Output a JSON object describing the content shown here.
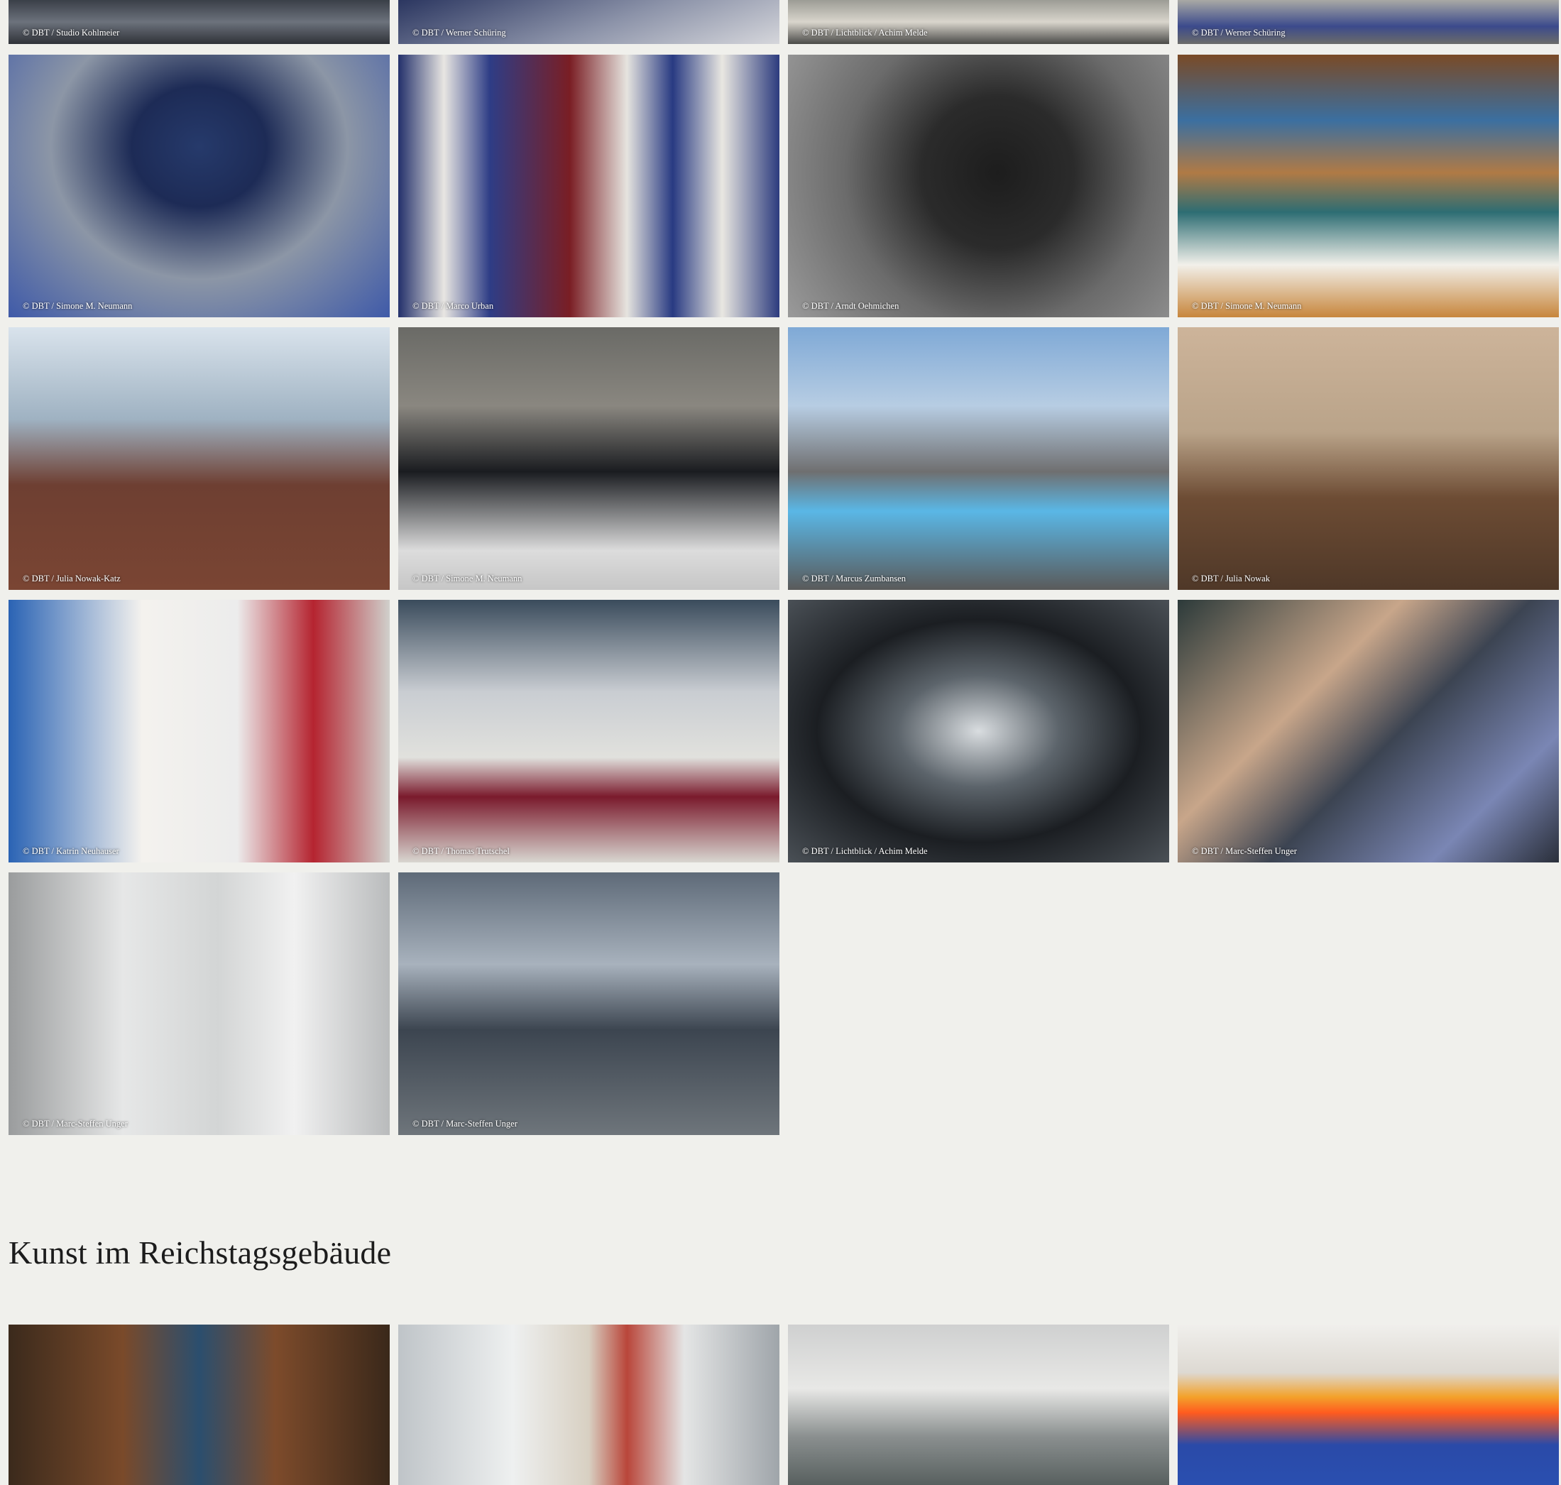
{
  "top_row": [
    {
      "credit": "© DBT / Studio Kohlmeier",
      "bg": "linear-gradient(180deg,#3a3f48 0%,#6c727c 50%,#2f3238 100%)"
    },
    {
      "credit": "© DBT / Werner Schüring",
      "bg": "linear-gradient(160deg,#2b3660 0%,#8c93a9 55%,#d5d6db 100%)"
    },
    {
      "credit": "© DBT / Lichtblick / Achim Melde",
      "bg": "linear-gradient(180deg,#9c9c95 0%,#d9d5cc 50%,#4a4a48 100%)"
    },
    {
      "credit": "© DBT / Werner Schüring",
      "bg": "linear-gradient(180deg,#a9a9a5 0%,#3b4a8c 60%,#6c6c69 100%)"
    }
  ],
  "photos": [
    {
      "credit": "© DBT / Simone M. Neumann",
      "bg": "radial-gradient(ellipse at 50% 35%,#263a6b 0%,#1d2b56 25%,#8c96a6 55%,#3f5aa8 100%)"
    },
    {
      "credit": "© DBT / Marco Urban",
      "bg": "linear-gradient(90deg,#23306b 0%,#e8e6e2 12%,#2e3d86 24%,#7a1e24 45%,#e6e4df 60%,#283a82 72%,#e9e7e1 85%,#2c3b7e 100%)"
    },
    {
      "credit": "© DBT / Arndt Oehmichen",
      "bg": "radial-gradient(circle at 55% 45%,#1d1d1d 0%,#2b2b2b 30%,#6b6b6b 60%,#9a9a9a 100%)"
    },
    {
      "credit": "© DBT / Simone M. Neumann",
      "bg": "linear-gradient(180deg,#7a4a26 0%,#3b6fa0 25%,#b07a45 45%,#2d6d73 60%,#f2f0ea 80%,#c7863c 100%)"
    },
    {
      "credit": "© DBT / Julia Nowak-Katz",
      "bg": "linear-gradient(180deg,#d9e3ec 0%,#9fb2c2 35%,#6e3f32 60%,#7a4533 100%)"
    },
    {
      "credit": "© DBT / Simone M. Neumann",
      "bg": "linear-gradient(180deg,#6a6a66 0%,#8a8780 30%,#1a1c20 55%,#dcdcdc 85%,#c6c6c6 100%)"
    },
    {
      "credit": "© DBT / Marcus Zumbansen",
      "bg": "linear-gradient(180deg,#7fa9d6 0%,#b7cde3 30%,#6f6f70 55%,#5ab7e6 70%,#5a5a5a 100%)"
    },
    {
      "credit": "© DBT / Julia Nowak",
      "bg": "linear-gradient(180deg,#cdb49a 0%,#b9a389 40%,#6d4c34 65%,#4f3828 100%)"
    },
    {
      "credit": "© DBT / Katrin Neuhauser",
      "bg": "linear-gradient(90deg,#2a63b4 0%,#f4f2ee 35%,#ececec 60%,#b52430 80%,#d0d0cc 100%)"
    },
    {
      "credit": "© DBT / Thomas Trutschel",
      "bg": "linear-gradient(180deg,#3a4b5c 0%,#c9cdd2 35%,#e1e1dd 60%,#7a1a2c 75%,#d8d6d0 100%)"
    },
    {
      "credit": "© DBT / Lichtblick / Achim Melde",
      "bg": "radial-gradient(ellipse at 50% 50%,#d9dde0 0%,#5c646b 30%,#1b1e22 60%,#4a5056 100%)"
    },
    {
      "credit": "© DBT / Marc-Steffen Unger",
      "bg": "linear-gradient(135deg,#2c3a3a 0%,#c8a68a 35%,#3c4452 55%,#7a86b4 80%,#2a2f3a 100%)"
    },
    {
      "credit": "© DBT / Marc-Steffen Unger",
      "bg": "linear-gradient(90deg,#9a9c9d 0%,#e6e7e7 30%,#d3d5d5 55%,#f1f1f1 75%,#b9bbbc 100%)"
    },
    {
      "credit": "© DBT / Marc-Steffen Unger",
      "bg": "linear-gradient(180deg,#5e6a78 0%,#a8b2bd 35%,#3c4550 60%,#6e757b 100%)"
    }
  ],
  "section": {
    "title": "Kunst im Reichstagsgebäude"
  },
  "kunst": [
    {
      "bg": "linear-gradient(90deg,#3b2a1c 0%,#7a4a2a 30%,#2b4e6e 50%,#7d4b2b 70%,#3a281a 100%)"
    },
    {
      "bg": "linear-gradient(90deg,#bfc4c8 0%,#eef0f0 30%,#d8d0c2 50%,#b9463a 60%,#e4e5e5 75%,#9fa5aa 100%)"
    },
    {
      "bg": "linear-gradient(180deg,#cfd0d0 0%,#e8e8e6 40%,#8a8f8f 70%,#58605f 100%)"
    },
    {
      "bg": "linear-gradient(180deg,#f0efec 0%,#ddd9d2 30%,#f3a22b 45%,#ff5b1f 55%,#2a4aa8 75%,#2a4fb0 100%)"
    }
  ]
}
